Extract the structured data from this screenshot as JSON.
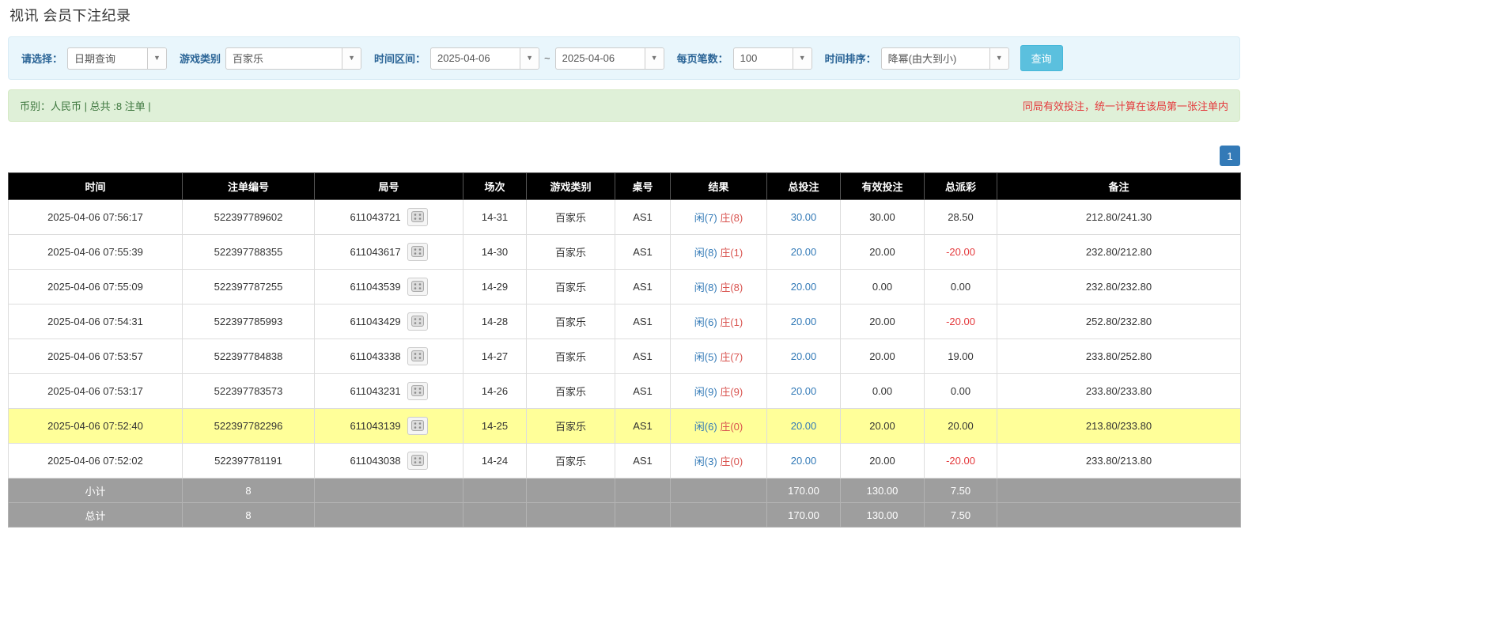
{
  "colors": {
    "accent_blue": "#337ab7",
    "player_blue": "#337ab7",
    "banker_red": "#d9534f",
    "negative_red": "#e4393c",
    "highlight_yellow": "#ffff99",
    "table_header_bg": "#000000",
    "totals_bg": "#9e9e9e",
    "filter_bar_bg": "#e9f6fc",
    "summary_bar_bg": "#dff0d8",
    "search_button_bg": "#5bc0de"
  },
  "page": {
    "title": "视讯 会员下注纪录"
  },
  "filters": {
    "select_label": "请选择：",
    "select_value": "日期查询",
    "game_label": "游戏类别",
    "game_value": "百家乐",
    "range_label": "时间区间：",
    "date_from": "2025-04-06",
    "range_sep": "~",
    "date_to": "2025-04-06",
    "per_page_label": "每页笔数：",
    "per_page_value": "100",
    "sort_label": "时间排序：",
    "sort_value": "降幂(由大到小)",
    "search_button": "查询"
  },
  "summary": {
    "left": "币别：人民币 | 总共 :8 注单 |",
    "right": "同局有效投注，统一计算在该局第一张注单内"
  },
  "pagination": {
    "current": "1"
  },
  "table": {
    "headers": [
      "时间",
      "注单编号",
      "局号",
      "场次",
      "游戏类别",
      "桌号",
      "结果",
      "总投注",
      "有效投注",
      "总派彩",
      "备注"
    ],
    "rows": [
      {
        "time": "2025-04-06 07:56:17",
        "bet_id": "522397789602",
        "round": "611043721",
        "session": "14-31",
        "game": "百家乐",
        "table": "AS1",
        "player": "闲(7)",
        "banker": "庄(8)",
        "total_bet": "30.00",
        "valid_bet": "30.00",
        "payout": "28.50",
        "remark": "212.80/241.30",
        "highlight": false
      },
      {
        "time": "2025-04-06 07:55:39",
        "bet_id": "522397788355",
        "round": "611043617",
        "session": "14-30",
        "game": "百家乐",
        "table": "AS1",
        "player": "闲(8)",
        "banker": "庄(1)",
        "total_bet": "20.00",
        "valid_bet": "20.00",
        "payout": "-20.00",
        "remark": "232.80/212.80",
        "highlight": false
      },
      {
        "time": "2025-04-06 07:55:09",
        "bet_id": "522397787255",
        "round": "611043539",
        "session": "14-29",
        "game": "百家乐",
        "table": "AS1",
        "player": "闲(8)",
        "banker": "庄(8)",
        "total_bet": "20.00",
        "valid_bet": "0.00",
        "payout": "0.00",
        "remark": "232.80/232.80",
        "highlight": false
      },
      {
        "time": "2025-04-06 07:54:31",
        "bet_id": "522397785993",
        "round": "611043429",
        "session": "14-28",
        "game": "百家乐",
        "table": "AS1",
        "player": "闲(6)",
        "banker": "庄(1)",
        "total_bet": "20.00",
        "valid_bet": "20.00",
        "payout": "-20.00",
        "remark": "252.80/232.80",
        "highlight": false
      },
      {
        "time": "2025-04-06 07:53:57",
        "bet_id": "522397784838",
        "round": "611043338",
        "session": "14-27",
        "game": "百家乐",
        "table": "AS1",
        "player": "闲(5)",
        "banker": "庄(7)",
        "total_bet": "20.00",
        "valid_bet": "20.00",
        "payout": "19.00",
        "remark": "233.80/252.80",
        "highlight": false
      },
      {
        "time": "2025-04-06 07:53:17",
        "bet_id": "522397783573",
        "round": "611043231",
        "session": "14-26",
        "game": "百家乐",
        "table": "AS1",
        "player": "闲(9)",
        "banker": "庄(9)",
        "total_bet": "20.00",
        "valid_bet": "0.00",
        "payout": "0.00",
        "remark": "233.80/233.80",
        "highlight": false
      },
      {
        "time": "2025-04-06 07:52:40",
        "bet_id": "522397782296",
        "round": "611043139",
        "session": "14-25",
        "game": "百家乐",
        "table": "AS1",
        "player": "闲(6)",
        "banker": "庄(0)",
        "total_bet": "20.00",
        "valid_bet": "20.00",
        "payout": "20.00",
        "remark": "213.80/233.80",
        "highlight": true
      },
      {
        "time": "2025-04-06 07:52:02",
        "bet_id": "522397781191",
        "round": "611043038",
        "session": "14-24",
        "game": "百家乐",
        "table": "AS1",
        "player": "闲(3)",
        "banker": "庄(0)",
        "total_bet": "20.00",
        "valid_bet": "20.00",
        "payout": "-20.00",
        "remark": "233.80/213.80",
        "highlight": false
      }
    ],
    "subtotal": {
      "label": "小计",
      "count": "8",
      "total_bet": "170.00",
      "valid_bet": "130.00",
      "payout": "7.50"
    },
    "total": {
      "label": "总计",
      "count": "8",
      "total_bet": "170.00",
      "valid_bet": "130.00",
      "payout": "7.50"
    }
  }
}
